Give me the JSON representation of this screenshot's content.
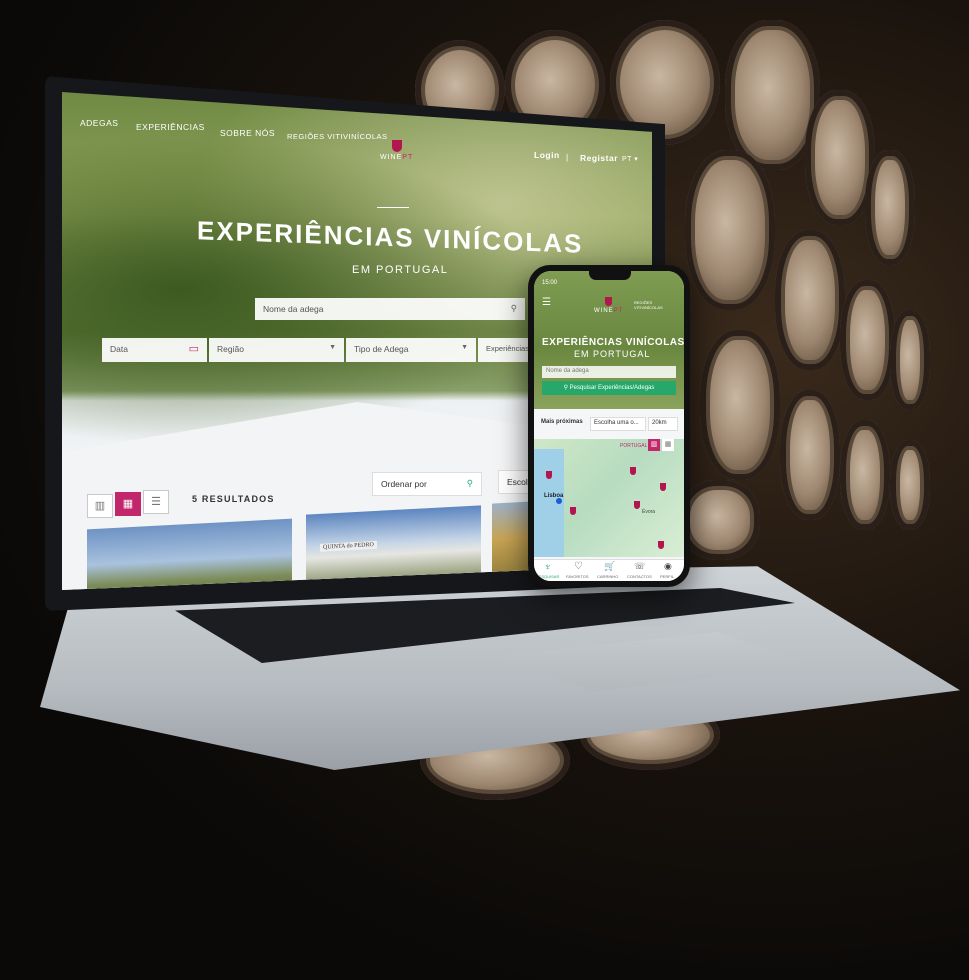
{
  "site": {
    "nav": [
      "ADEGAS",
      "EXPERIÊNCIAS",
      "SOBRE NÓS",
      "REGIÕES VITIVINÍCOLAS"
    ],
    "brand": "WINE",
    "brand_accent": "PT",
    "auth": {
      "login": "Login",
      "separator": "|",
      "register": "Registar",
      "lang": "PT ▾"
    },
    "hero_title": "EXPERIÊNCIAS VINÍCOLAS",
    "hero_subtitle": "EM PORTUGAL",
    "search_placeholder": "Nome da adega",
    "filters": {
      "date": "Data",
      "region": "Região",
      "type": "Tipo de Adega",
      "experiences": "Experiências"
    },
    "results": "5  RESULTADOS",
    "order_by": "Ordenar por",
    "choose": "Escolha",
    "card_sign": "QUINTA do PEDRO",
    "accent": "#c2276c"
  },
  "phone": {
    "time": "15:00",
    "brand": "WINE",
    "brand_accent": "PT",
    "regions_link": "REGIÕES VITIVINÍCOLAS",
    "hero_title": "EXPERIÊNCIAS VINÍCOLAS",
    "hero_subtitle": "EM PORTUGAL",
    "search_placeholder": "Nome da adega",
    "search_button": "Pesquisar Experiências/Adegas",
    "filters": [
      "Mais próximas",
      "Escolha uma o...",
      "20km"
    ],
    "map_label": "PORTUGAL",
    "city_1": "Lisboa",
    "city_2": "Évora",
    "tabs": [
      "PESQUISAR",
      "FAVORITOS",
      "CARRINHO",
      "CONTACTOS",
      "PERFIL"
    ],
    "accent": "#26a86a"
  }
}
